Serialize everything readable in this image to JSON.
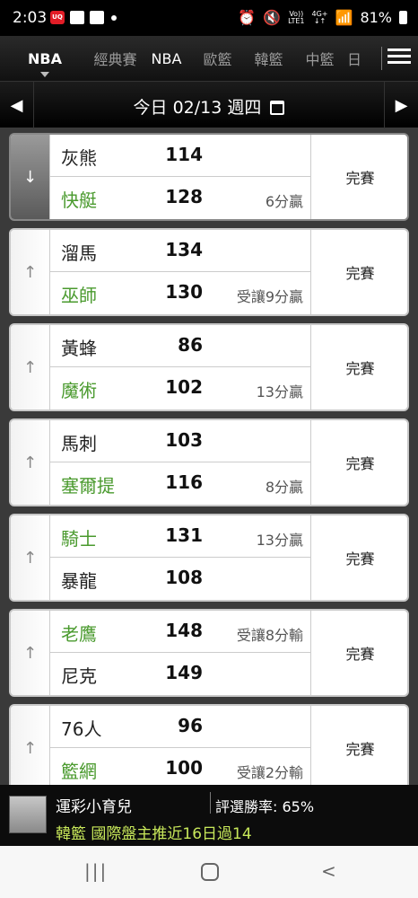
{
  "statusbar": {
    "time": "2:03",
    "icons": [
      "uniqlo-app-icon",
      "message-icon",
      "gallery-icon",
      "dot-icon"
    ],
    "right_icons": [
      "alarm-icon",
      "mute-icon",
      "volte-icon",
      "4g-icon",
      "signal-icon",
      "battery-icon"
    ],
    "volte_top": "Vo))",
    "volte_bottom": "LTE1",
    "lte_top": "4G+",
    "lte_bottom": "↓↑",
    "battery": "81%"
  },
  "tabs": [
    {
      "label": "NBA",
      "active": true
    },
    {
      "label": "經典賽",
      "active": false
    },
    {
      "label": "NBA",
      "active": false
    },
    {
      "label": "歐籃",
      "active": false
    },
    {
      "label": "韓籃",
      "active": false
    },
    {
      "label": "中籃",
      "active": false
    },
    {
      "label": "日",
      "active": false
    }
  ],
  "datebar": {
    "prev": "◀",
    "next": "▶",
    "date_text": "今日 02/13 週四"
  },
  "games": [
    {
      "away": "灰熊",
      "away_score": "114",
      "away_note": "",
      "home": "快艇",
      "home_score": "128",
      "home_note": "6分贏",
      "green": "home",
      "status": "完賽",
      "arrow": "↓"
    },
    {
      "away": "溜馬",
      "away_score": "134",
      "away_note": "",
      "home": "巫師",
      "home_score": "130",
      "home_note": "受讓9分贏",
      "green": "home",
      "status": "完賽",
      "arrow": "↑"
    },
    {
      "away": "黃蜂",
      "away_score": "86",
      "away_note": "",
      "home": "魔術",
      "home_score": "102",
      "home_note": "13分贏",
      "green": "home",
      "status": "完賽",
      "arrow": "↑"
    },
    {
      "away": "馬刺",
      "away_score": "103",
      "away_note": "",
      "home": "塞爾提",
      "home_score": "116",
      "home_note": "8分贏",
      "green": "home",
      "status": "完賽",
      "arrow": "↑"
    },
    {
      "away": "騎士",
      "away_score": "131",
      "away_note": "13分贏",
      "home": "暴龍",
      "home_score": "108",
      "home_note": "",
      "green": "away",
      "status": "完賽",
      "arrow": "↑"
    },
    {
      "away": "老鷹",
      "away_score": "148",
      "away_note": "受讓8分輸",
      "home": "尼克",
      "home_score": "149",
      "home_note": "",
      "green": "away",
      "status": "完賽",
      "arrow": "↑"
    },
    {
      "away": "76人",
      "away_score": "96",
      "away_note": "",
      "home": "籃網",
      "home_score": "100",
      "home_note": "受讓2分輸",
      "green": "home",
      "status": "完賽",
      "arrow": "↑"
    }
  ],
  "promo": {
    "name": "運彩小育兒",
    "rate": "評選勝率: 65%",
    "headline": "韓籃 國際盤主推近16日過14"
  },
  "navbar": {
    "recents": "|||",
    "back": "<"
  },
  "colors": {
    "winner_green": "#4a9a2e",
    "promo_headline": "#c8e85a"
  }
}
